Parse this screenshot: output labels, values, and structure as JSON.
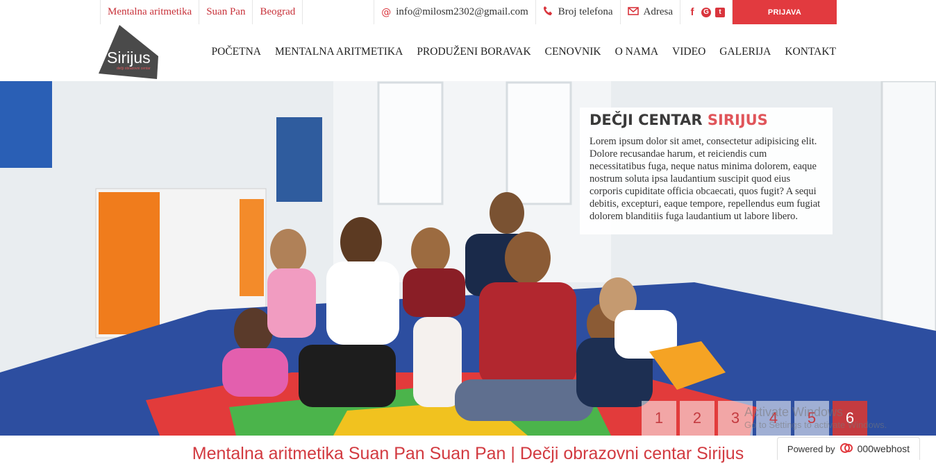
{
  "topbar": {
    "links": [
      "Mentalna aritmetika",
      "Suan Pan",
      "Beograd"
    ],
    "email": "info@milosm2302@gmail.com",
    "phone": "Broj telefona",
    "address": "Adresa",
    "login": "PRIJAVA"
  },
  "logo": {
    "text": "Sirijus",
    "tagline": "dečji obrazovni centar"
  },
  "nav": [
    "POČETNA",
    "MENTALNA ARITMETIKA",
    "PRODUŽENI BORAVAK",
    "CENOVNIK",
    "O NAMA",
    "VIDEO",
    "GALERIJA",
    "KONTAKT"
  ],
  "hero": {
    "title_main": "DEČJI CENTAR",
    "title_accent": "SIRIJUS",
    "text": "Lorem ipsum dolor sit amet, consectetur adipisicing elit. Dolore recusandae harum, et reiciendis cum necessitatibus fuga, neque natus minima dolorem, eaque nostrum soluta ipsa laudantium suscipit quod eius corporis cupiditate officia obcaecati, quos fugit? A sequi debitis, excepturi, eaque tempore, repellendus eum fugiat dolorem blanditiis fuga laudantium ut labore libero.",
    "pages": [
      "1",
      "2",
      "3",
      "4",
      "5",
      "6"
    ],
    "active_page": "6"
  },
  "headline": "Mentalna aritmetika Suan Pan Suan Pan | Dečji obrazovni centar Sirijus",
  "watermark": {
    "line1": "Activate Windows",
    "line2": "Go to Settings to activate Windows."
  },
  "powered": {
    "label": "Powered by",
    "brand": "000webhost"
  },
  "colors": {
    "accent": "#e23a3f",
    "nav_text": "#222222"
  }
}
